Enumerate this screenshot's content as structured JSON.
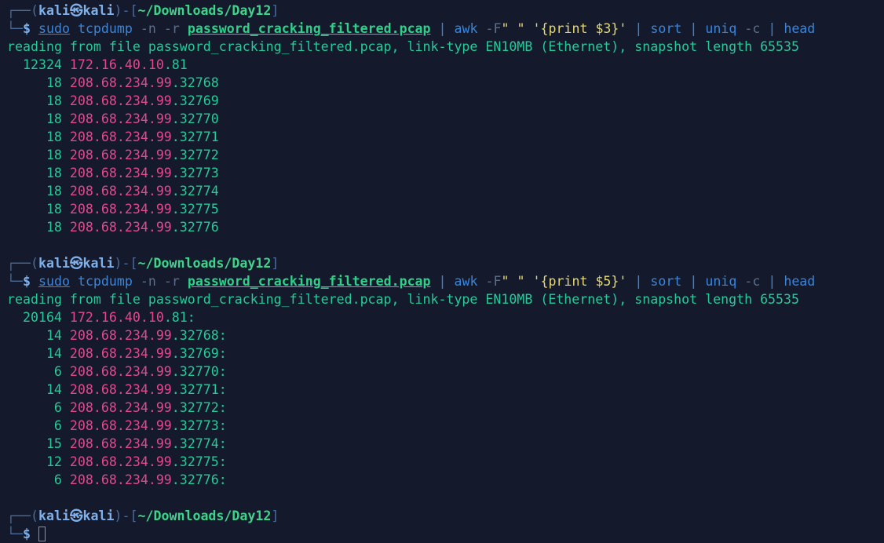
{
  "prompt": {
    "frame_top": "┌──",
    "frame_bottom": "└─",
    "dash": "-",
    "open_paren": "(",
    "close_paren": ")",
    "open_bracket": "[",
    "close_bracket": "]",
    "user": "kali",
    "at_symbol": "㉿",
    "host": "kali",
    "path": "~/Downloads/Day12",
    "dollar": "$"
  },
  "commands": [
    {
      "sudo": "sudo",
      "tool": "tcpdump",
      "flags": "-n -r",
      "file": "password_cracking_filtered.pcap",
      "pipe1": "|",
      "awk": "awk",
      "awk_flag": "-F",
      "awk_sep": "\" \"",
      "awk_open": "'{",
      "awk_print": "print",
      "awk_var": "$3",
      "awk_close": "}'",
      "pipe2": "|",
      "sort": "sort",
      "pipe3": "|",
      "uniq": "uniq",
      "uniq_flag": "-c",
      "pipe4": "|",
      "head": "head"
    },
    {
      "sudo": "sudo",
      "tool": "tcpdump",
      "flags": "-n -r",
      "file": "password_cracking_filtered.pcap",
      "pipe1": "|",
      "awk": "awk",
      "awk_flag": "-F",
      "awk_sep": "\" \"",
      "awk_open": "'{",
      "awk_print": "print",
      "awk_var": "$5",
      "awk_close": "}'",
      "pipe2": "|",
      "sort": "sort",
      "pipe3": "|",
      "uniq": "uniq",
      "uniq_flag": "-c",
      "pipe4": "|",
      "head": "head"
    }
  ],
  "info_line": "reading from file password_cracking_filtered.pcap, link-type EN10MB (Ethernet), snapshot length 65535",
  "output1": [
    {
      "count": "12324",
      "ip": "172.16.40.10",
      "port": ".81"
    },
    {
      "count": "18",
      "ip": "208.68.234.99",
      "port": ".32768"
    },
    {
      "count": "18",
      "ip": "208.68.234.99",
      "port": ".32769"
    },
    {
      "count": "18",
      "ip": "208.68.234.99",
      "port": ".32770"
    },
    {
      "count": "18",
      "ip": "208.68.234.99",
      "port": ".32771"
    },
    {
      "count": "18",
      "ip": "208.68.234.99",
      "port": ".32772"
    },
    {
      "count": "18",
      "ip": "208.68.234.99",
      "port": ".32773"
    },
    {
      "count": "18",
      "ip": "208.68.234.99",
      "port": ".32774"
    },
    {
      "count": "18",
      "ip": "208.68.234.99",
      "port": ".32775"
    },
    {
      "count": "18",
      "ip": "208.68.234.99",
      "port": ".32776"
    }
  ],
  "output2": [
    {
      "count": "20164",
      "ip": "172.16.40.10",
      "port": ".81:"
    },
    {
      "count": "14",
      "ip": "208.68.234.99",
      "port": ".32768:"
    },
    {
      "count": "14",
      "ip": "208.68.234.99",
      "port": ".32769:"
    },
    {
      "count": "6",
      "ip": "208.68.234.99",
      "port": ".32770:"
    },
    {
      "count": "14",
      "ip": "208.68.234.99",
      "port": ".32771:"
    },
    {
      "count": "6",
      "ip": "208.68.234.99",
      "port": ".32772:"
    },
    {
      "count": "6",
      "ip": "208.68.234.99",
      "port": ".32773:"
    },
    {
      "count": "15",
      "ip": "208.68.234.99",
      "port": ".32774:"
    },
    {
      "count": "12",
      "ip": "208.68.234.99",
      "port": ".32775:"
    },
    {
      "count": "6",
      "ip": "208.68.234.99",
      "port": ".32776:"
    }
  ],
  "colors": {
    "background": "#141a2b",
    "output_green": "#27c99a",
    "ip_pink": "#e14a8d",
    "command_blue": "#3a84d9",
    "string_yellow": "#e3d873"
  }
}
